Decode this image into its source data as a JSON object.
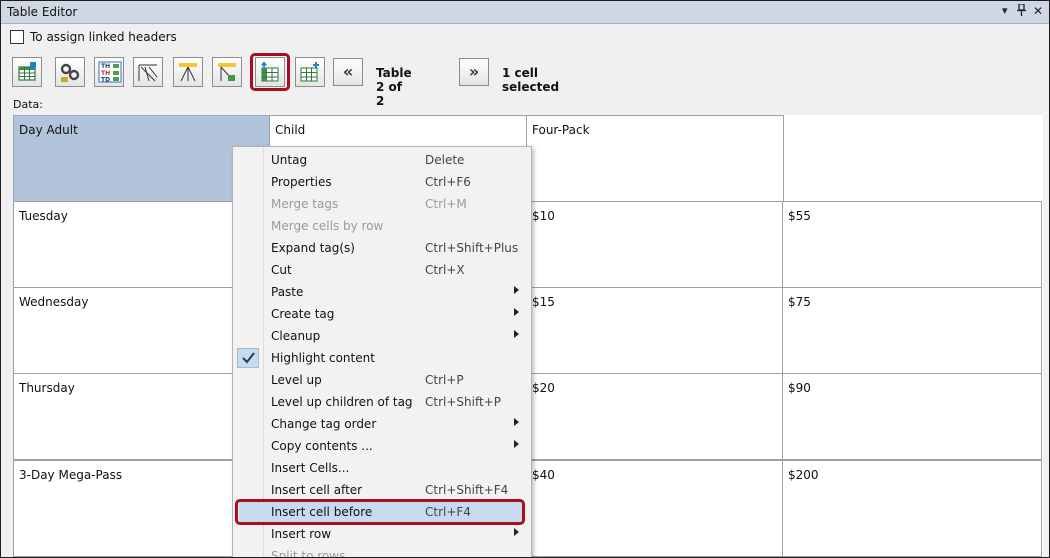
{
  "window": {
    "title": "Table Editor",
    "controls": [
      "▾",
      "⊥",
      "✕"
    ]
  },
  "assign_checkbox": {
    "label": "To assign linked headers",
    "checked": false
  },
  "toolbar": {
    "icons": [
      "table-grid-icon",
      "link-cells-icon",
      "th-td-icon",
      "column-header-icon",
      "row-header-icon",
      "assign-scope-icon",
      "insert-column-icon",
      "insert-row-icon"
    ],
    "table_label": "Table 2 of 2",
    "prev_label": "«",
    "next_label": "»",
    "selection_label": "1 cell selected"
  },
  "data_label": "Data:",
  "table": {
    "rows": [
      [
        "Day  Adult",
        "Child",
        "Four-Pack",
        ""
      ],
      [
        "Tuesday",
        "",
        "$10",
        "$55"
      ],
      [
        "Wednesday",
        "",
        "$15",
        "$75"
      ],
      [
        "Thursday",
        "",
        "$20",
        "$90"
      ],
      [
        "3-Day  Mega-Pass",
        "",
        "$40",
        "$200"
      ]
    ]
  },
  "context_menu": {
    "items": [
      {
        "label": "Untag",
        "shortcut": "Delete",
        "disabled": false,
        "submenu": false,
        "checked": false
      },
      {
        "label": "Properties",
        "shortcut": "Ctrl+F6",
        "disabled": false,
        "submenu": false,
        "checked": false
      },
      {
        "label": "Merge tags",
        "shortcut": "Ctrl+M",
        "disabled": true,
        "submenu": false,
        "checked": false
      },
      {
        "label": "Merge cells by row",
        "shortcut": "",
        "disabled": true,
        "submenu": false,
        "checked": false
      },
      {
        "label": "Expand tag(s)",
        "shortcut": "Ctrl+Shift+Plus",
        "disabled": false,
        "submenu": false,
        "checked": false
      },
      {
        "label": "Cut",
        "shortcut": "Ctrl+X",
        "disabled": false,
        "submenu": false,
        "checked": false
      },
      {
        "label": "Paste",
        "shortcut": "",
        "disabled": false,
        "submenu": true,
        "checked": false
      },
      {
        "label": "Create tag",
        "shortcut": "",
        "disabled": false,
        "submenu": true,
        "checked": false
      },
      {
        "label": "Cleanup",
        "shortcut": "",
        "disabled": false,
        "submenu": true,
        "checked": false
      },
      {
        "label": "Highlight content",
        "shortcut": "",
        "disabled": false,
        "submenu": false,
        "checked": true
      },
      {
        "label": "Level up",
        "shortcut": "Ctrl+P",
        "disabled": false,
        "submenu": false,
        "checked": false
      },
      {
        "label": "Level up children of tag",
        "shortcut": "Ctrl+Shift+P",
        "disabled": false,
        "submenu": false,
        "checked": false
      },
      {
        "label": "Change tag order",
        "shortcut": "",
        "disabled": false,
        "submenu": true,
        "checked": false
      },
      {
        "label": "Copy contents ...",
        "shortcut": "",
        "disabled": false,
        "submenu": true,
        "checked": false
      },
      {
        "label": "Insert Cells...",
        "shortcut": "",
        "disabled": false,
        "submenu": false,
        "checked": false
      },
      {
        "label": "Insert cell after",
        "shortcut": "Ctrl+Shift+F4",
        "disabled": false,
        "submenu": false,
        "checked": false
      },
      {
        "label": "Insert cell before",
        "shortcut": "Ctrl+F4",
        "disabled": false,
        "submenu": false,
        "checked": false,
        "highlighted": true
      },
      {
        "label": "Insert row",
        "shortcut": "",
        "disabled": false,
        "submenu": true,
        "checked": false
      },
      {
        "label": "Split to rows",
        "shortcut": "",
        "disabled": true,
        "submenu": false,
        "checked": false
      }
    ]
  },
  "colors": {
    "accent_highlight": "#a50f1f",
    "selected_cell": "#b2c3dc",
    "menu_hover": "#c7dbef",
    "titlebar": "#cfd7e4"
  }
}
